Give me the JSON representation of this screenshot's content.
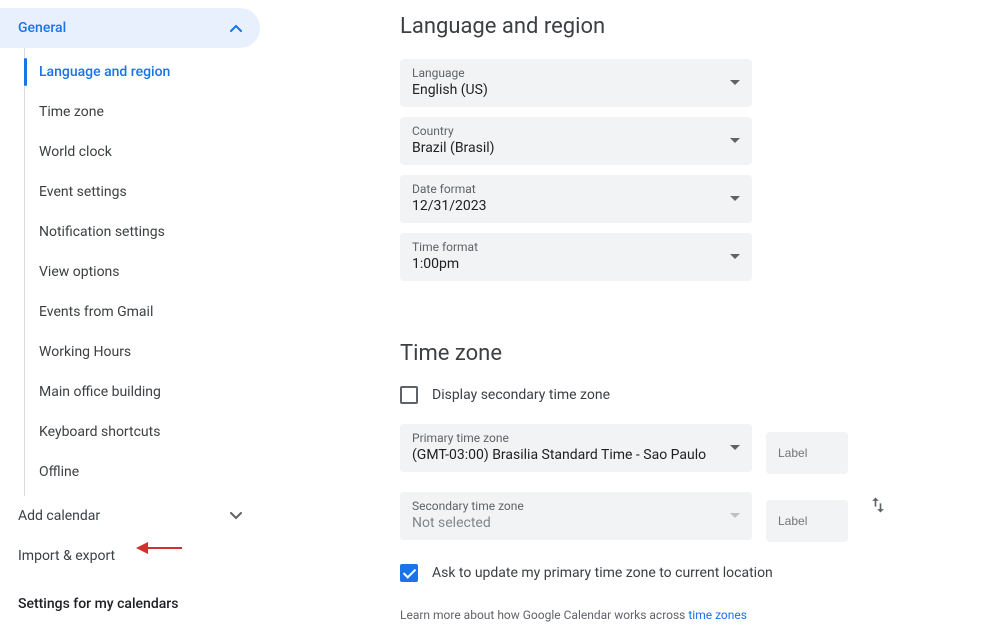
{
  "sidebar": {
    "general": "General",
    "items": [
      "Language and region",
      "Time zone",
      "World clock",
      "Event settings",
      "Notification settings",
      "View options",
      "Events from Gmail",
      "Working Hours",
      "Main office building",
      "Keyboard shortcuts",
      "Offline"
    ],
    "add_calendar": "Add calendar",
    "import_export": "Import & export",
    "settings_heading": "Settings for my calendars"
  },
  "lang_region": {
    "title": "Language and region",
    "fields": {
      "language": {
        "label": "Language",
        "value": "English (US)"
      },
      "country": {
        "label": "Country",
        "value": "Brazil (Brasil)"
      },
      "date_format": {
        "label": "Date format",
        "value": "12/31/2023"
      },
      "time_format": {
        "label": "Time format",
        "value": "1:00pm"
      }
    }
  },
  "timezone": {
    "title": "Time zone",
    "display_secondary": "Display secondary time zone",
    "primary": {
      "label": "Primary time zone",
      "value": "(GMT-03:00) Brasilia Standard Time - Sao Paulo"
    },
    "secondary": {
      "label": "Secondary time zone",
      "value": "Not selected"
    },
    "label_placeholder": "Label",
    "ask_update": "Ask to update my primary time zone to current location",
    "help_prefix": "Learn more about how Google Calendar works across ",
    "help_link": "time zones"
  }
}
